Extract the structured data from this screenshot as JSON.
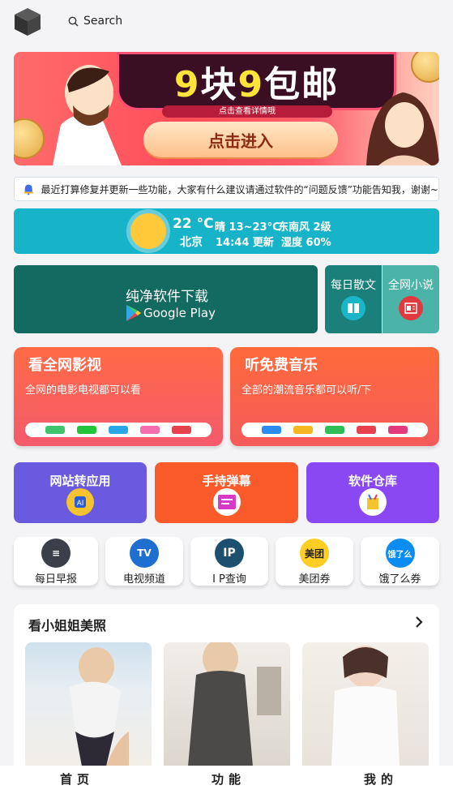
{
  "header": {
    "search_label": "Search",
    "logo_icon": "cube-logo-icon"
  },
  "banner": {
    "headline_nine_1": "9",
    "headline_text_1": "块",
    "headline_nine_2": "9",
    "headline_text_2": "包邮",
    "sub": "点击查看详情哦",
    "enter_label": "点击进入"
  },
  "notice": {
    "text": "最近打算修复并更新一些功能，大家有什么建议请通过软件的“问题反馈”功能告知我，谢谢~",
    "icon": "bell-icon"
  },
  "weather": {
    "temp": "22 °C",
    "city": "北京",
    "condition": "晴 13~23°C",
    "updated": "14:44 更新",
    "wind": "东南风 2级",
    "humidity": "湿度 60%"
  },
  "download": {
    "title": "纯净软件下载",
    "store": "Google Play"
  },
  "mini": [
    {
      "label": "每日散文",
      "icon": "book-icon"
    },
    {
      "label": "全网小说",
      "icon": "reader-icon"
    }
  ],
  "cards": [
    {
      "title": "看全网影视",
      "desc": "全网的电影电视都可以看",
      "icon": "video-apps-strip"
    },
    {
      "title": "听免费音乐",
      "desc": "全部的潮流音乐都可以听/下",
      "icon": "music-apps-strip"
    }
  ],
  "tiles": [
    {
      "label": "网站转应用",
      "icon": "app-convert-icon"
    },
    {
      "label": "手持弹幕",
      "icon": "danmaku-icon"
    },
    {
      "label": "软件仓库",
      "icon": "software-repo-icon"
    }
  ],
  "quick": [
    {
      "label": "每日早报",
      "icon": "news-icon",
      "glyph": "≡"
    },
    {
      "label": "电视频道",
      "icon": "tv-icon",
      "glyph": "TV"
    },
    {
      "label": "I P查询",
      "icon": "ip-icon",
      "glyph": "IP"
    },
    {
      "label": "美团券",
      "icon": "meituan-icon",
      "glyph": "美团"
    },
    {
      "label": "饿了么券",
      "icon": "eleme-icon",
      "glyph": "饿了么"
    }
  ],
  "gallery": {
    "title": "看小姐姐美照"
  },
  "bottom_nav": [
    {
      "label": "首页"
    },
    {
      "label": "功能"
    },
    {
      "label": "我的"
    }
  ]
}
